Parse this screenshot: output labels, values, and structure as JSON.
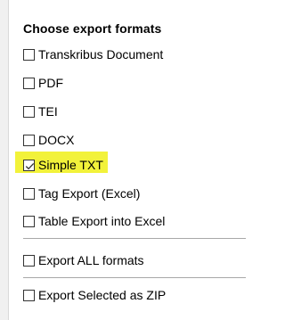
{
  "panel": {
    "title": "Choose export formats"
  },
  "options": [
    {
      "label": "Transkribus Document",
      "checked": false
    },
    {
      "label": "PDF",
      "checked": false
    },
    {
      "label": "TEI",
      "checked": false
    },
    {
      "label": "DOCX",
      "checked": false
    },
    {
      "label": "Simple TXT",
      "checked": true,
      "highlighted": true
    },
    {
      "label": "Tag Export (Excel)",
      "checked": false
    },
    {
      "label": "Table Export into Excel",
      "checked": false
    }
  ],
  "export_all": {
    "label": "Export ALL formats",
    "checked": false
  },
  "export_zip": {
    "label": "Export Selected as ZIP",
    "checked": false
  },
  "colors": {
    "highlight": "#f2f23a",
    "checkbox_border": "#333333",
    "divider": "#a8a8a8",
    "strip": "#f0f0f0"
  }
}
